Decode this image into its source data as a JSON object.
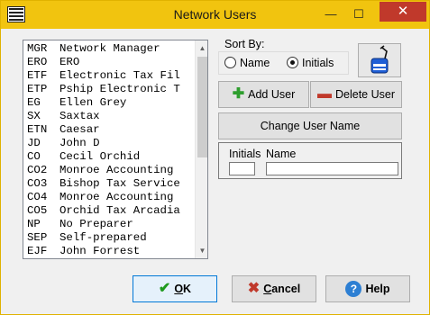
{
  "window": {
    "title": "Network Users",
    "controls": {
      "minimize": "—",
      "maximize": "☐",
      "close": "✕"
    }
  },
  "users": [
    {
      "code": "MGR",
      "name": "Network Manager"
    },
    {
      "code": "ERO",
      "name": "ERO"
    },
    {
      "code": "ETF",
      "name": "Electronic Tax Fil"
    },
    {
      "code": "ETP",
      "name": "Pship Electronic T"
    },
    {
      "code": "EG",
      "name": "Ellen Grey"
    },
    {
      "code": "SX",
      "name": "Saxtax"
    },
    {
      "code": "ETN",
      "name": "Caesar"
    },
    {
      "code": "JD",
      "name": "John D"
    },
    {
      "code": "CO",
      "name": "Cecil Orchid"
    },
    {
      "code": "CO2",
      "name": "Monroe Accounting"
    },
    {
      "code": "CO3",
      "name": "Bishop Tax Service"
    },
    {
      "code": "CO4",
      "name": "Monroe Accounting"
    },
    {
      "code": "CO5",
      "name": "Orchid Tax Arcadia"
    },
    {
      "code": "NP",
      "name": "No Preparer"
    },
    {
      "code": "SEP",
      "name": "Self-prepared"
    },
    {
      "code": "EJF",
      "name": "John Forrest"
    }
  ],
  "sort": {
    "label": "Sort By:",
    "options": [
      {
        "label": "Name",
        "selected": false
      },
      {
        "label": "Initials",
        "selected": true
      }
    ]
  },
  "buttons": {
    "add_user": "Add User",
    "delete_user": "Delete User",
    "change_user_name": "Change User Name",
    "ok_underlined": "O",
    "ok_rest": "K",
    "cancel_underlined": "C",
    "cancel_rest": "ancel",
    "help": "Help"
  },
  "edit": {
    "initials_label": "Initials",
    "name_label": "Name",
    "initials_value": "",
    "name_value": ""
  },
  "colors": {
    "titlebar": "#f1c40f",
    "close_button": "#c0392b",
    "add_icon": "#2e9e2e",
    "delete_icon": "#c0392b",
    "ok_icon": "#1e9a1e",
    "help_icon": "#2d7fd3"
  },
  "icons": {
    "app": "app-logo-icon",
    "tool": "network-plug-icon",
    "add": "plus-icon",
    "delete": "minus-icon",
    "ok": "checkmark-icon",
    "cancel": "x-icon",
    "help": "question-icon"
  }
}
